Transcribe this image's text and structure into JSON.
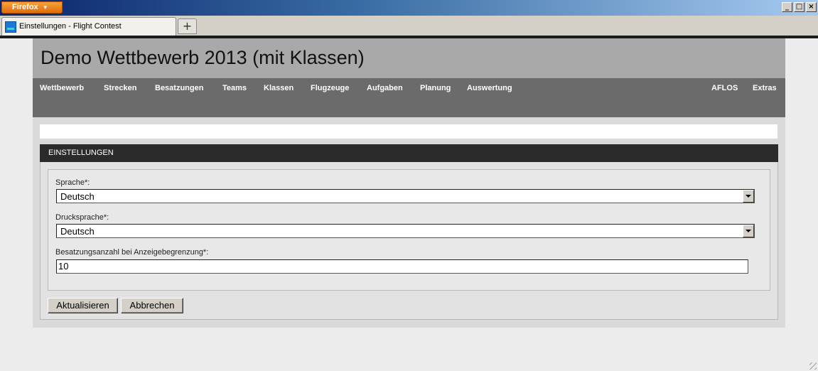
{
  "browser": {
    "menu_button": "Firefox",
    "tab_title": "Einstellungen - Flight Contest",
    "new_tab_symbol": "+",
    "window_buttons": [
      "_",
      "□",
      "×"
    ]
  },
  "page": {
    "title": "Demo Wettbewerb 2013 (mit Klassen)",
    "nav_left": [
      "Wettbewerb",
      "Strecken",
      "Besatzungen",
      "Teams",
      "Klassen",
      "Flugzeuge",
      "Aufgaben",
      "Planung",
      "Auswertung"
    ],
    "nav_right": [
      "AFLOS",
      "Extras"
    ]
  },
  "settings": {
    "heading": "EINSTELLUNGEN",
    "language": {
      "label": "Sprache*:",
      "value": "Deutsch"
    },
    "print_language": {
      "label": "Drucksprache*:",
      "value": "Deutsch"
    },
    "crew_count": {
      "label": "Besatzungsanzahl bei Anzeigebegrenzung*:",
      "value": "10"
    },
    "update_button": "Aktualisieren",
    "cancel_button": "Abbrechen"
  }
}
